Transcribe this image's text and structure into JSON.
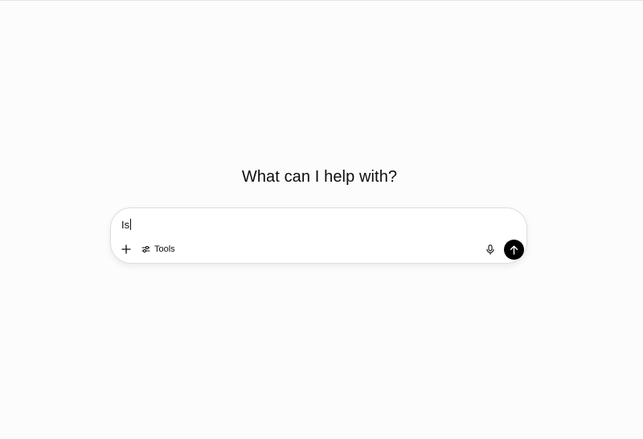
{
  "heading": "What can I help with?",
  "composer": {
    "value": "Is",
    "tools_label": "Tools",
    "icons": {
      "add": "plus-icon",
      "tools": "sliders-icon",
      "mic": "microphone-icon",
      "send": "arrow-up-icon"
    }
  },
  "colors": {
    "background": "#fcfcfc",
    "send_button": "#000000",
    "text": "#0d0d0d"
  }
}
